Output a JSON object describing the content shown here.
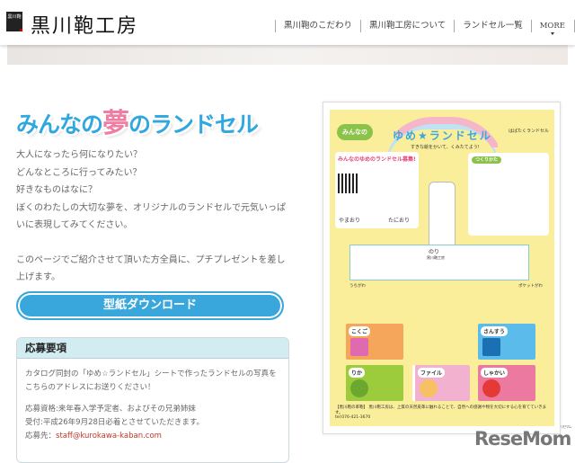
{
  "header": {
    "logo_mark": "黒川鞄",
    "logo_text": "黒川鞄工房",
    "nav": [
      "黒川鞄のこだわり",
      "黒川鞄工房について",
      "ランドセル一覧",
      "MORE"
    ]
  },
  "main": {
    "title_pre": "みんなの",
    "title_yume": "夢",
    "title_post": "のランドセル",
    "intro": [
      "大人になったら何になりたい？",
      "どんなところに行ってみたい？",
      "好きなものはなに？",
      "ぼくのわたしの大切な夢を、オリジナルのランドセルで元気いっぱいに表現してみてください。"
    ],
    "present": "このページでご紹介させて頂いた方全員に、プチプレゼントを差し上げます。",
    "download_button": "型紙ダウンロード",
    "box": {
      "heading": "応募要項",
      "body": "カタログ同封の「ゆめ☆ランドセル」シートで作ったランドセルの写真をこちらのアドレスにお送りください！",
      "eligibility": "応募資格:来年春入学予定者、およびその兄弟姉妹",
      "deadline": "受付:平成26年9月28日必着とさせていただきます。",
      "address_label": "応募先：",
      "email": "staff@kurokawa-kaban.com"
    }
  },
  "poster": {
    "minna": "みんなの",
    "title": "ゆめ★ランドセル",
    "subtitle": "すきな絵をかいて、くみたてよう!",
    "brand": "はばたくランドセル",
    "info_title": "みんなのゆめのランドセル募集!",
    "how_title": "つくりかた",
    "yamaori": "やまおり",
    "taniori": "たにおり",
    "uchigawa": "うちがわ",
    "pocket": "ポケットがわ",
    "nori": "のり",
    "maker": "黒川鞄工房",
    "subjects": [
      "こくご",
      "さんすう",
      "りか",
      "ファイル",
      "しゃかい"
    ],
    "footer": "【黒川鞄の革鞄】 黒川鞄工房は、上質の天然皮革に触れることで、自然への感謝や物を大切にする心を育てていきます。",
    "tel": "tel:076-421-3670"
  },
  "watermark": {
    "text": "ReseMom",
    "ruby": "リセマム"
  }
}
